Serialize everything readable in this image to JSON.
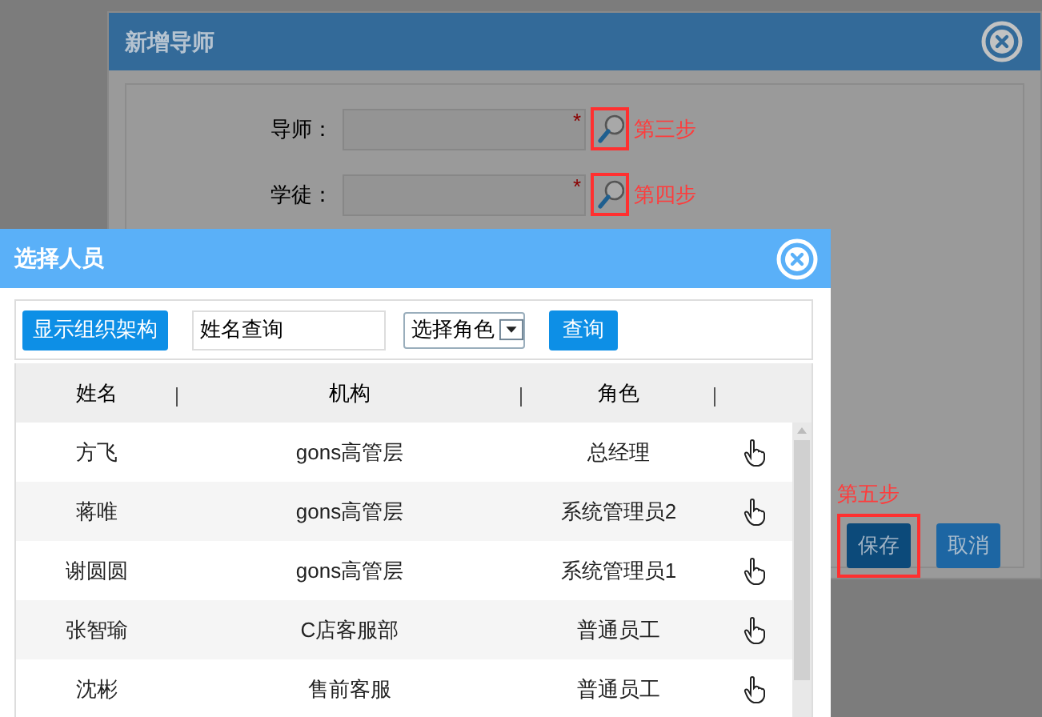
{
  "back_dialog": {
    "title": "新增导师",
    "fields": [
      {
        "label": "导师：",
        "required_mark": "*",
        "step": "第三步"
      },
      {
        "label": "学徒：",
        "required_mark": "*",
        "step": "第四步"
      }
    ],
    "buttons_step": "第五步",
    "buttons": [
      {
        "label": "保存",
        "kind": "primary",
        "highlighted": true
      },
      {
        "label": "取消",
        "kind": "secondary",
        "highlighted": false
      }
    ]
  },
  "select_dialog": {
    "title": "选择人员",
    "toolbar": {
      "org_button": "显示组织架构",
      "name_search": {
        "value": "姓名查询"
      },
      "role_select": {
        "value": "选择角色"
      },
      "query_button": "查询"
    },
    "table": {
      "columns": [
        "姓名",
        "机构",
        "角色"
      ],
      "rows": [
        {
          "name": "方飞",
          "org": "gons高管层",
          "role": "总经理"
        },
        {
          "name": "蒋唯",
          "org": "gons高管层",
          "role": "系统管理员2"
        },
        {
          "name": "谢圆圆",
          "org": "gons高管层",
          "role": "系统管理员1"
        },
        {
          "name": "张智瑜",
          "org": "C店客服部",
          "role": "普通员工"
        },
        {
          "name": "沈彬",
          "org": "售前客服",
          "role": "普通员工"
        }
      ]
    }
  }
}
